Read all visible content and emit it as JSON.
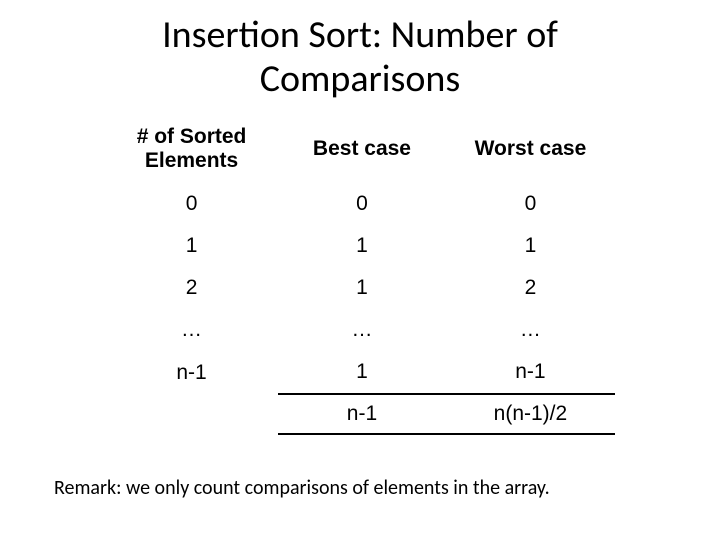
{
  "title_line1": "Insertion Sort: Number of",
  "title_line2": "Comparisons",
  "headers": {
    "col0a": "# of Sorted",
    "col0b": "Elements",
    "col1": "Best case",
    "col2": "Worst case"
  },
  "rows": [
    {
      "sorted": "0",
      "best": "0",
      "worst": "0"
    },
    {
      "sorted": "1",
      "best": "1",
      "worst": "1"
    },
    {
      "sorted": "2",
      "best": "1",
      "worst": "2"
    },
    {
      "sorted": "…",
      "best": "…",
      "worst": "…"
    },
    {
      "sorted": "n-1",
      "best": "1",
      "worst": "n-1"
    }
  ],
  "totals": {
    "best": "n-1",
    "worst": "n(n-1)/2"
  },
  "remark": "Remark: we only count comparisons of elements in the array.",
  "chart_data": {
    "type": "table",
    "title": "Insertion Sort: Number of Comparisons",
    "columns": [
      "# of Sorted Elements",
      "Best case",
      "Worst case"
    ],
    "rows": [
      [
        "0",
        "0",
        "0"
      ],
      [
        "1",
        "1",
        "1"
      ],
      [
        "2",
        "1",
        "2"
      ],
      [
        "…",
        "…",
        "…"
      ],
      [
        "n-1",
        "1",
        "n-1"
      ]
    ],
    "totals": {
      "Best case": "n-1",
      "Worst case": "n(n-1)/2"
    }
  }
}
